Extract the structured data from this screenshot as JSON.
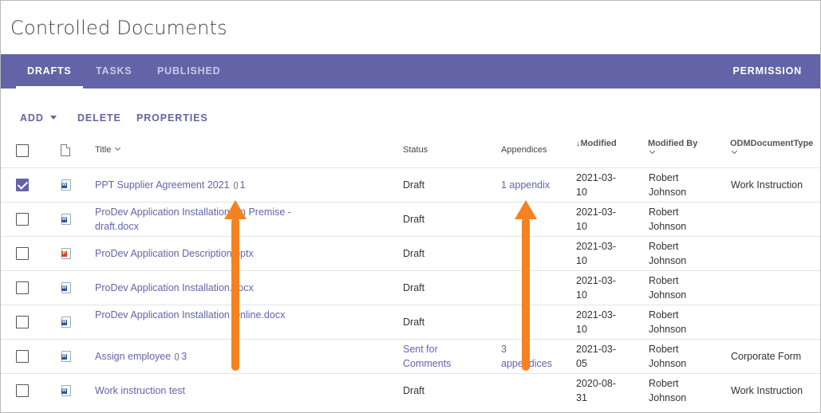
{
  "page_title": "Controlled Documents",
  "tabs": [
    {
      "label": "DRAFTS",
      "active": true
    },
    {
      "label": "TASKS",
      "active": false
    },
    {
      "label": "PUBLISHED",
      "active": false
    }
  ],
  "permission_label": "PERMISSION",
  "toolbar": {
    "add_label": "ADD",
    "delete_label": "DELETE",
    "properties_label": "PROPERTIES"
  },
  "columns": {
    "title": "Title",
    "status": "Status",
    "appendices": "Appendices",
    "modified": "Modified",
    "modified_by": "Modified By",
    "doc_type": "ODMDocumentType"
  },
  "rows": [
    {
      "checked": true,
      "icon": "word-doc-icon",
      "title": "PPT Supplier Agreement 2021",
      "attachments": "1",
      "status": "Draft",
      "status_link": false,
      "appendices": "1 appendix",
      "modified": "2021-03-10",
      "modified_by": "Robert Johnson",
      "doc_type": "Work Instruction"
    },
    {
      "checked": false,
      "icon": "word-doc-icon",
      "title": "ProDev Application Installation On Premise - draft.docx",
      "attachments": "",
      "status": "Draft",
      "status_link": false,
      "appendices": "",
      "modified": "2021-03-10",
      "modified_by": "Robert Johnson",
      "doc_type": ""
    },
    {
      "checked": false,
      "icon": "ppt-doc-icon",
      "title": "ProDev Application Description.pptx",
      "attachments": "",
      "status": "Draft",
      "status_link": false,
      "appendices": "",
      "modified": "2021-03-10",
      "modified_by": "Robert Johnson",
      "doc_type": ""
    },
    {
      "checked": false,
      "icon": "word-doc-icon",
      "title": "ProDev Application Installation.docx",
      "attachments": "",
      "status": "Draft",
      "status_link": false,
      "appendices": "",
      "modified": "2021-03-10",
      "modified_by": "Robert Johnson",
      "doc_type": ""
    },
    {
      "checked": false,
      "icon": "word-doc-icon",
      "title": "ProDev Application Installation Online.docx",
      "attachments": "",
      "status": "Draft",
      "status_link": false,
      "appendices": "",
      "modified": "2021-03-10",
      "modified_by": "Robert Johnson",
      "doc_type": ""
    },
    {
      "checked": false,
      "icon": "word-doc-icon",
      "title": "Assign employee",
      "attachments": "3",
      "status": "Sent for Comments",
      "status_link": true,
      "appendices": "3 appendices",
      "modified": "2021-03-05",
      "modified_by": "Robert Johnson",
      "doc_type": "Corporate Form"
    },
    {
      "checked": false,
      "icon": "word-doc-icon",
      "title": "Work instruction test",
      "attachments": "",
      "status": "Draft",
      "status_link": false,
      "appendices": "",
      "modified": "2020-08-31",
      "modified_by": "Robert Johnson",
      "doc_type": "Work Instruction"
    }
  ],
  "colors": {
    "accent": "#6264a7",
    "arrow": "#f58220"
  }
}
